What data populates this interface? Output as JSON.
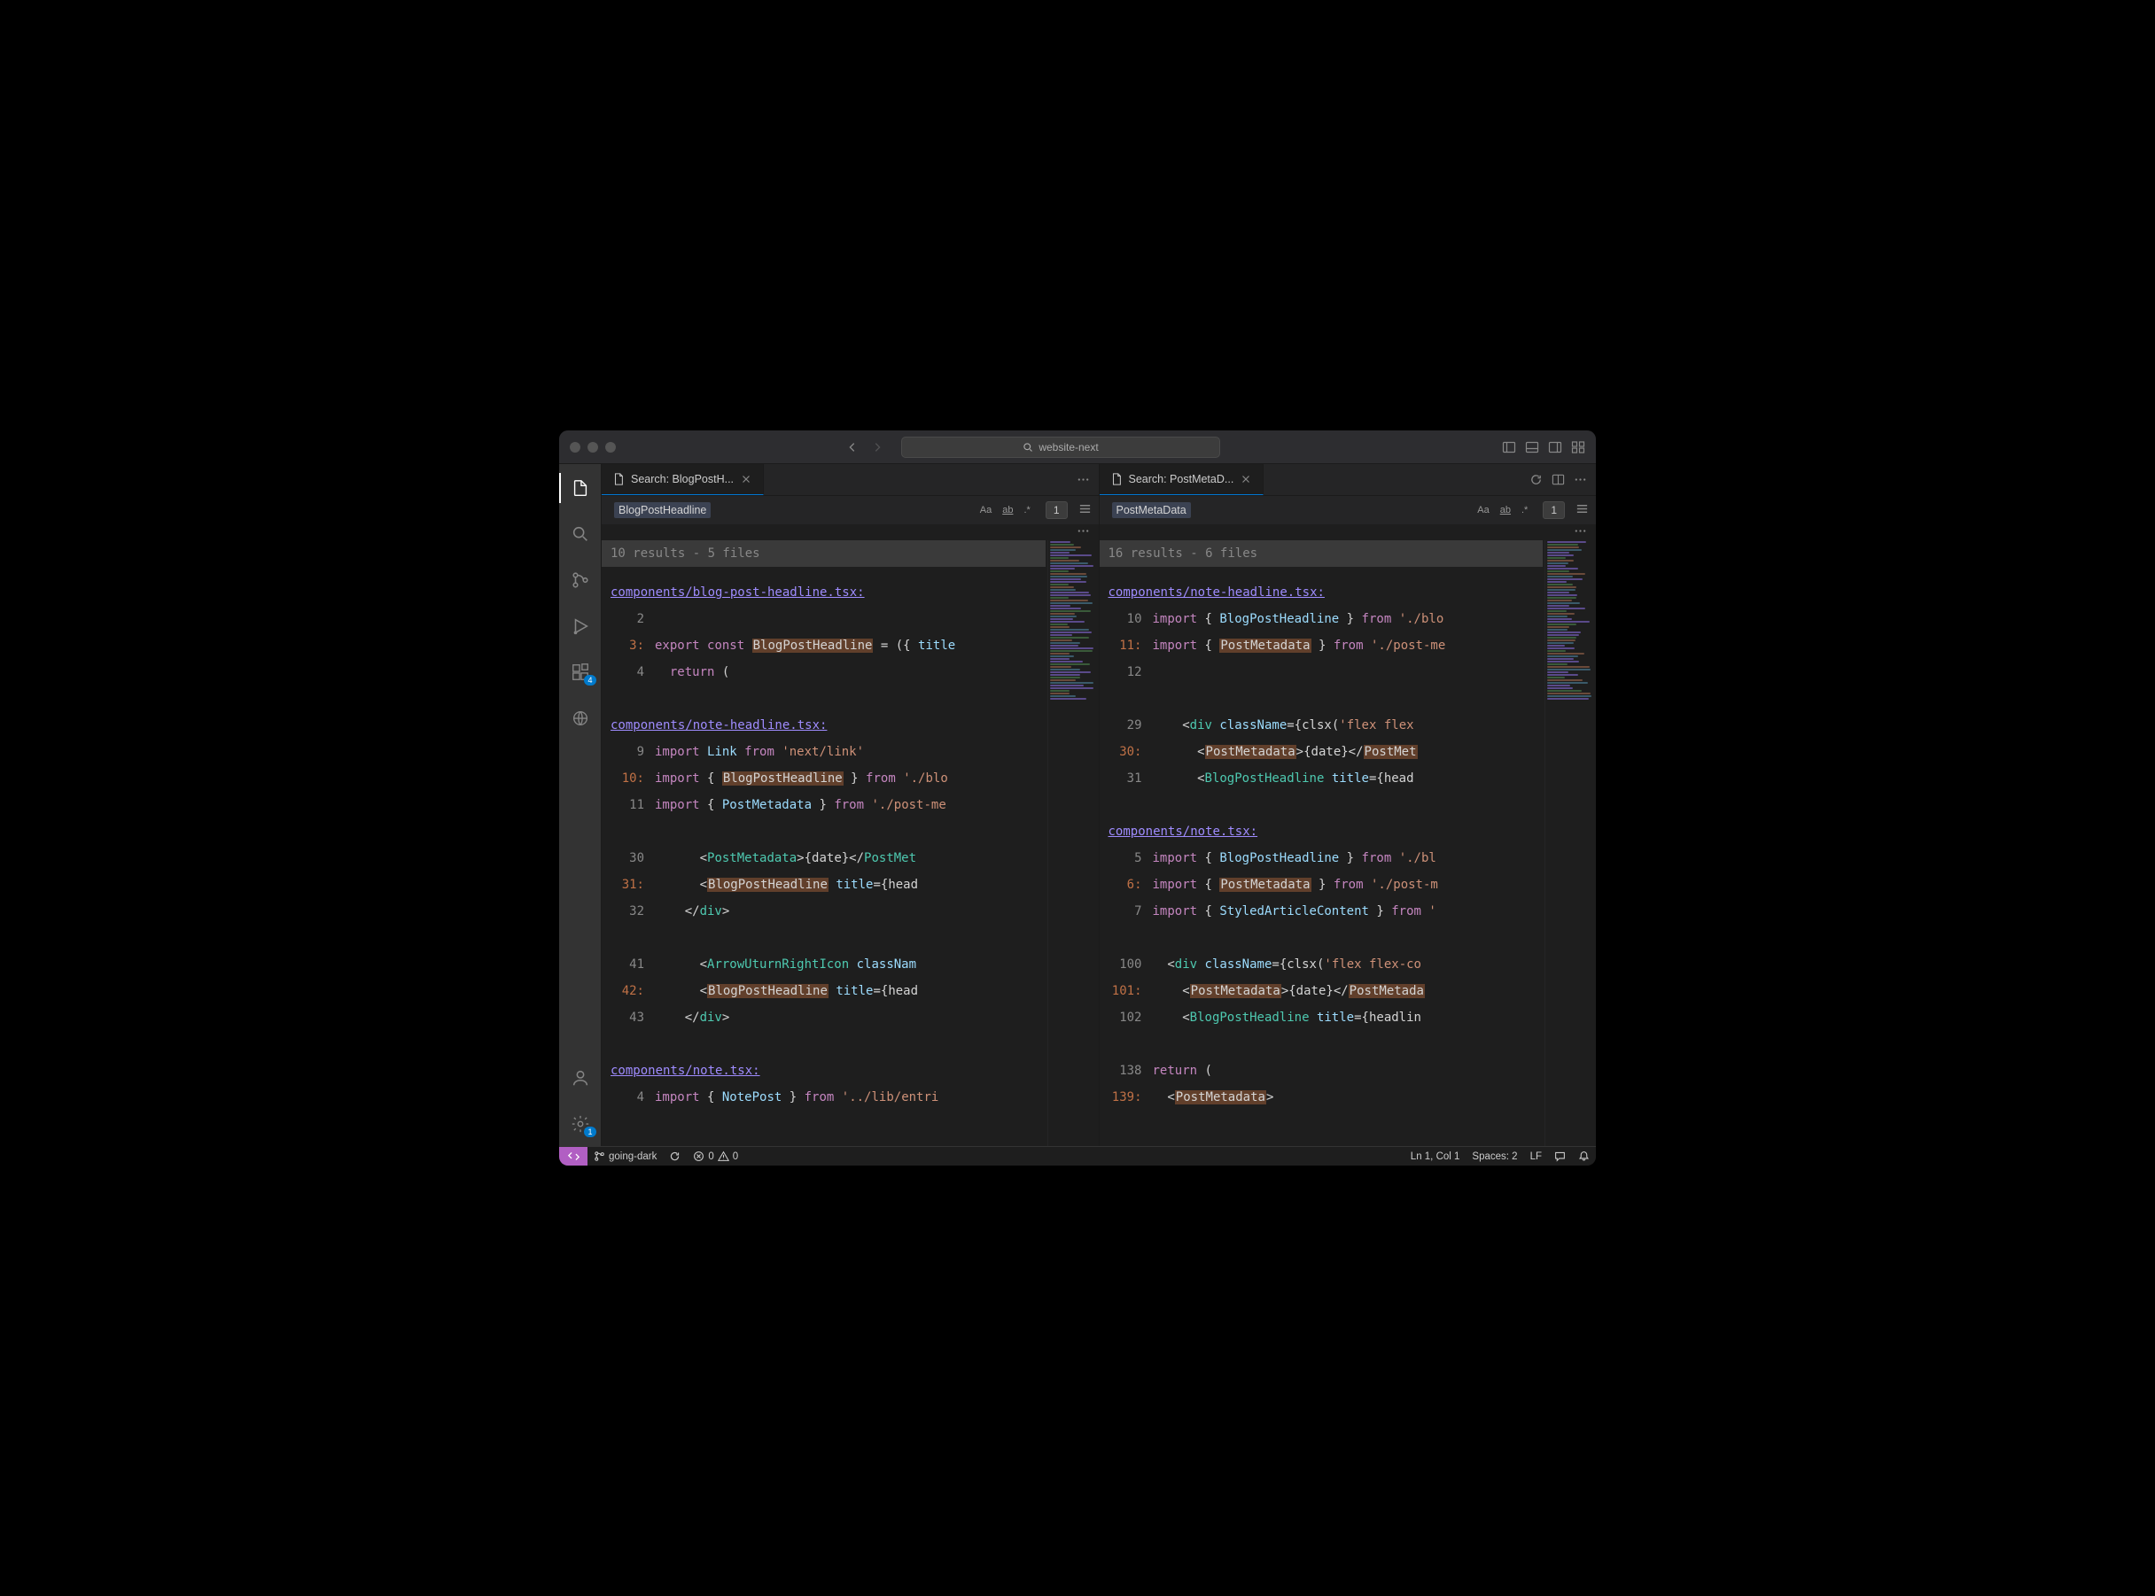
{
  "titlebar": {
    "search_label": "website-next"
  },
  "activitybar": {
    "ext_badge": "4",
    "gear_badge": "1"
  },
  "statusbar": {
    "branch": "going-dark",
    "errors": "0",
    "warnings": "0",
    "cursor": "Ln 1, Col 1",
    "spaces": "Spaces: 2",
    "eol": "LF"
  },
  "left": {
    "tab_label": "Search: BlogPostH...",
    "term": "BlogPostHeadline",
    "count": "1",
    "summary": "10 results - 5 files",
    "files": [
      {
        "path": "components/blog-post-headline.tsx:",
        "lines": [
          {
            "n": "2",
            "match": false,
            "html": ""
          },
          {
            "n": "3:",
            "match": true,
            "html": "<span class='kw'>export</span> <span class='kw'>const</span> <span class='hl'>BlogPostHeadline</span> = ({ <span class='id'>title</span>"
          },
          {
            "n": "4",
            "match": false,
            "html": "  <span class='kw'>return</span> ("
          }
        ]
      },
      {
        "path": "components/note-headline.tsx:",
        "lines": [
          {
            "n": "9",
            "match": false,
            "html": "<span class='kw'>import</span> <span class='id'>Link</span> <span class='kw'>from</span> <span class='str'>'next/link'</span>"
          },
          {
            "n": "10:",
            "match": true,
            "html": "<span class='kw'>import</span> { <span class='hl'>BlogPostHeadline</span> } <span class='kw'>from</span> <span class='str'>'./blo</span>"
          },
          {
            "n": "11",
            "match": false,
            "html": "<span class='kw'>import</span> { <span class='id'>PostMetadata</span> } <span class='kw'>from</span> <span class='str'>'./post-me</span>"
          },
          {
            "n": "",
            "match": false,
            "html": "",
            "spacer": true
          },
          {
            "n": "30",
            "match": false,
            "html": "      &lt;<span class='tag'>PostMetadata</span>&gt;{date}&lt;/<span class='tag'>PostMet</span>"
          },
          {
            "n": "31:",
            "match": true,
            "html": "      &lt;<span class='hl'>BlogPostHeadline</span> <span class='attr'>title</span>={head"
          },
          {
            "n": "32",
            "match": false,
            "html": "    &lt;/<span class='tag'>div</span>&gt;"
          },
          {
            "n": "",
            "match": false,
            "html": "",
            "spacer": true
          },
          {
            "n": "41",
            "match": false,
            "html": "      &lt;<span class='tag'>ArrowUturnRightIcon</span> <span class='attr'>classNam</span>"
          },
          {
            "n": "42:",
            "match": true,
            "html": "      &lt;<span class='hl'>BlogPostHeadline</span> <span class='attr'>title</span>={head"
          },
          {
            "n": "43",
            "match": false,
            "html": "    &lt;/<span class='tag'>div</span>&gt;"
          }
        ]
      },
      {
        "path": "components/note.tsx:",
        "lines": [
          {
            "n": "4",
            "match": false,
            "html": "<span class='kw'>import</span> { <span class='id'>NotePost</span> } <span class='kw'>from</span> <span class='str'>'../lib/entri</span>"
          }
        ]
      }
    ]
  },
  "right": {
    "tab_label": "Search: PostMetaD...",
    "term": "PostMetaData",
    "count": "1",
    "summary": "16 results - 6 files",
    "files": [
      {
        "path": "components/note-headline.tsx:",
        "lines": [
          {
            "n": "10",
            "match": false,
            "html": "<span class='kw'>import</span> { <span class='id'>BlogPostHeadline</span> } <span class='kw'>from</span> <span class='str'>'./blo</span>"
          },
          {
            "n": "11:",
            "match": true,
            "html": "<span class='kw'>import</span> { <span class='hl'>PostMetadata</span> } <span class='kw'>from</span> <span class='str'>'./post-me</span>"
          },
          {
            "n": "12",
            "match": false,
            "html": ""
          },
          {
            "n": "",
            "match": false,
            "html": "",
            "spacer": true
          },
          {
            "n": "29",
            "match": false,
            "html": "    &lt;<span class='tag'>div</span> <span class='attr'>className</span>={clsx(<span class='str'>'flex flex</span>"
          },
          {
            "n": "30:",
            "match": true,
            "html": "      &lt;<span class='hl'>PostMetadata</span>&gt;{date}&lt;/<span class='hl'>PostMet</span>"
          },
          {
            "n": "31",
            "match": false,
            "html": "      &lt;<span class='tag'>BlogPostHeadline</span> <span class='attr'>title</span>={head"
          }
        ]
      },
      {
        "path": "components/note.tsx:",
        "lines": [
          {
            "n": "5",
            "match": false,
            "html": "<span class='kw'>import</span> { <span class='id'>BlogPostHeadline</span> } <span class='kw'>from</span> <span class='str'>'./bl</span>"
          },
          {
            "n": "6:",
            "match": true,
            "html": "<span class='kw'>import</span> { <span class='hl'>PostMetadata</span> } <span class='kw'>from</span> <span class='str'>'./post-m</span>"
          },
          {
            "n": "7",
            "match": false,
            "html": "<span class='kw'>import</span> { <span class='id'>StyledArticleContent</span> } <span class='kw'>from</span> <span class='str'>'</span>"
          },
          {
            "n": "",
            "match": false,
            "html": "",
            "spacer": true
          },
          {
            "n": "100",
            "match": false,
            "html": "  &lt;<span class='tag'>div</span> <span class='attr'>className</span>={clsx(<span class='str'>'flex flex-co</span>"
          },
          {
            "n": "101:",
            "match": true,
            "html": "    &lt;<span class='hl'>PostMetadata</span>&gt;{date}&lt;/<span class='hl'>PostMetada</span>"
          },
          {
            "n": "102",
            "match": false,
            "html": "    &lt;<span class='tag'>BlogPostHeadline</span> <span class='attr'>title</span>={headlin"
          },
          {
            "n": "",
            "match": false,
            "html": "",
            "spacer": true
          },
          {
            "n": "138",
            "match": false,
            "html": "<span class='kw'>return</span> ("
          },
          {
            "n": "139:",
            "match": true,
            "html": "  &lt;<span class='hl'>PostMetadata</span>&gt;"
          }
        ]
      }
    ]
  }
}
